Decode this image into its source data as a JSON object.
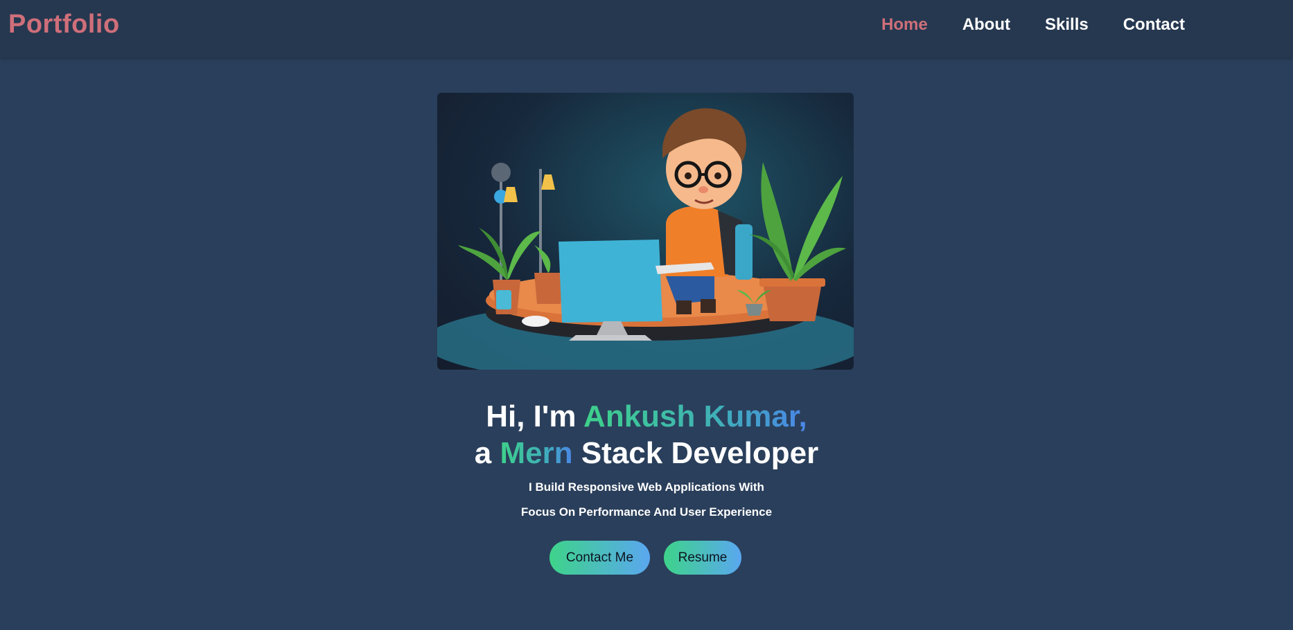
{
  "nav": {
    "logo": "Portfolio",
    "links": [
      {
        "label": "Home",
        "active": true
      },
      {
        "label": "About",
        "active": false
      },
      {
        "label": "Skills",
        "active": false
      },
      {
        "label": "Contact",
        "active": false
      }
    ]
  },
  "hero": {
    "image_alt": "3D cartoon developer working on computer",
    "line1_prefix": "Hi, I'm",
    "name": "Ankush Kumar,",
    "line2_prefix": "a",
    "stack": "Mern",
    "line2_suffix": "Stack Developer",
    "subtitle_line1": "I Build Responsive Web Applications With",
    "subtitle_line2": "Focus On Performance And User Experience",
    "contact_button": "Contact Me",
    "resume_button": "Resume"
  },
  "colors": {
    "background": "#2a3f5b",
    "navbar": "#263850",
    "accent": "#cf6f7a",
    "gradient_start": "#3ed18a",
    "gradient_end": "#4a86e8"
  }
}
